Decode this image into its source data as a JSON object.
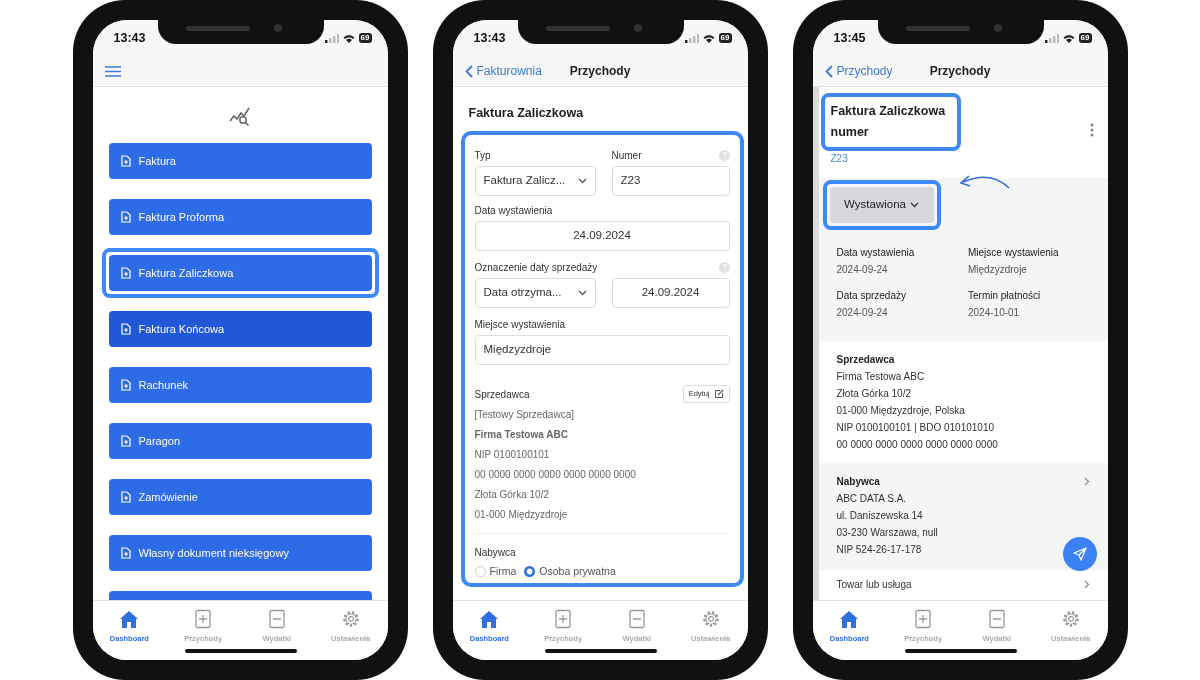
{
  "phones": [
    {
      "kind": "dashboard",
      "status_bar": {
        "time": "13:43",
        "battery": "69"
      },
      "header": {
        "menu_button": true
      },
      "buttons": [
        {
          "label": "Faktura",
          "pressed": false,
          "highlighted": false
        },
        {
          "label": "Faktura Proforma",
          "pressed": false,
          "highlighted": false
        },
        {
          "label": "Faktura Zaliczkowa",
          "pressed": false,
          "highlighted": true
        },
        {
          "label": "Faktura Końcowa",
          "pressed": true,
          "highlighted": false
        },
        {
          "label": "Rachunek",
          "pressed": false,
          "highlighted": false
        },
        {
          "label": "Paragon",
          "pressed": false,
          "highlighted": false
        },
        {
          "label": "Zamówienie",
          "pressed": false,
          "highlighted": false
        },
        {
          "label": "Własny dokument nieksięgowy",
          "pressed": false,
          "highlighted": false
        },
        {
          "pressed": false,
          "highlighted": false
        }
      ],
      "tab_bar": [
        {
          "kind": "home",
          "label": "Dashboard",
          "selected": true
        },
        {
          "kind": "plus",
          "label": "Przychody",
          "selected": false
        },
        {
          "kind": "minus",
          "label": "Wydatki",
          "selected": false
        },
        {
          "kind": "gear",
          "label": "Ustawienia",
          "selected": false
        }
      ]
    },
    {
      "kind": "form",
      "status_bar": {
        "time": "13:43",
        "battery": "69"
      },
      "header": {
        "back": "Fakturownia",
        "title": "Przychody"
      },
      "title": "Faktura Zaliczkowa",
      "form": {
        "highlighted": true,
        "type": {
          "label": "Typ",
          "value": "Faktura Zalicz..."
        },
        "number": {
          "label": "Numer",
          "value": "Z23",
          "help": true
        },
        "issue_date": {
          "label": "Data wystawienia",
          "value": "24.09.2024"
        },
        "sale_date": {
          "label": "Oznaczenie daty sprzedaży",
          "help": true,
          "mode": "Data otrzyma...",
          "value": "24.09.2024"
        },
        "place": {
          "label": "Miejsce wystawienia",
          "value": "Międzyzdroje"
        },
        "seller": {
          "label": "Sprzedawca",
          "edit_button": "Edytuj",
          "lines": [
            {
              "text": "[Testowy Sprzedawca]",
              "bold": false
            },
            {
              "text": "Firma Testowa ABC",
              "bold": true
            },
            {
              "text": "NIP 0100100101",
              "bold": false
            },
            {
              "text": "00 0000 0000 0000 0000 0000 0000",
              "bold": false
            },
            {
              "text": "Złota Górka 10/2",
              "bold": false
            },
            {
              "text": "01-000 Międzyzdroje",
              "bold": false
            }
          ]
        },
        "buyer": {
          "label": "Nabywca",
          "options": [
            {
              "label": "Firma",
              "selected": false
            },
            {
              "label": "Osoba prywatna",
              "selected": true
            }
          ]
        }
      },
      "tab_bar": [
        {
          "kind": "home",
          "label": "Dashboard",
          "selected": true
        },
        {
          "kind": "plus",
          "label": "Przychody",
          "selected": false
        },
        {
          "kind": "minus",
          "label": "Wydatki",
          "selected": false
        },
        {
          "kind": "gear",
          "label": "Ustawienia",
          "selected": false
        }
      ]
    },
    {
      "kind": "details",
      "status_bar": {
        "time": "13:45",
        "battery": "69"
      },
      "header": {
        "back": "Przychody",
        "title": "Przychody"
      },
      "title": {
        "text": "Faktura Zaliczkowa numer",
        "highlighted": true
      },
      "number": "Z23",
      "status_button": {
        "label": "Wystawiona",
        "highlighted": true,
        "pointer_arrow": true
      },
      "details": [
        {
          "label": "Data wystawienia",
          "value": "2024-09-24"
        },
        {
          "label": "Miejsce wystawienia",
          "value": "Międzyzdroje"
        },
        {
          "label": "Data sprzedaży",
          "value": "2024-09-24"
        },
        {
          "label": "Termin płatności",
          "value": "2024-10-01"
        }
      ],
      "seller": {
        "title": "Sprzedawca",
        "lines": [
          "Firma Testowa ABC",
          "Złota Górka 10/2",
          "01-000 Międzyzdroje, Polska",
          "NIP 0100100101 | BDO 010101010",
          "00 0000 0000 0000 0000 0000 0000"
        ]
      },
      "buyer": {
        "title": "Nabywca",
        "lines": [
          "ABC DATA S.A.",
          "ul. Daniszewska 14",
          "03-230 Warszawa, null",
          "NIP 524-26-17-178"
        ]
      },
      "items_row": "Towar lub usługa",
      "tab_bar": [
        {
          "kind": "home",
          "label": "Dashboard",
          "selected": true
        },
        {
          "kind": "plus",
          "label": "Przychody",
          "selected": false
        },
        {
          "kind": "minus",
          "label": "Wydatki",
          "selected": false
        },
        {
          "kind": "gear",
          "label": "Ustawienia",
          "selected": false
        }
      ]
    }
  ]
}
